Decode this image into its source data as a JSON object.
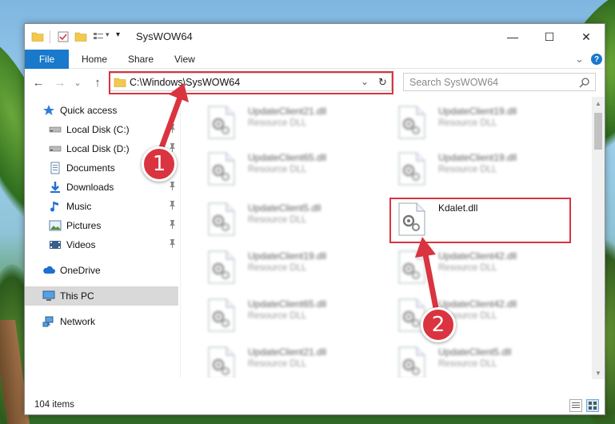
{
  "window": {
    "title": "SysWOW64",
    "minimize": "—",
    "maximize": "☐",
    "close": "✕"
  },
  "ribbon": {
    "tabs": [
      "File",
      "Home",
      "Share",
      "View"
    ],
    "collapse": "⌄",
    "help": "?"
  },
  "navbar": {
    "back": "←",
    "forward": "→",
    "recent": "⌄",
    "up": "↑",
    "address": "C:\\Windows\\SysWOW64",
    "dropdown": "⌄",
    "refresh": "↻",
    "search_placeholder": "Search SysWOW64"
  },
  "sidebar": {
    "items": [
      {
        "label": "Quick access",
        "icon": "star-icon",
        "pinned": false
      },
      {
        "label": "Local Disk (C:)",
        "icon": "drive-icon",
        "pinned": true
      },
      {
        "label": "Local Disk (D:)",
        "icon": "drive-icon",
        "pinned": true
      },
      {
        "label": "Documents",
        "icon": "documents-icon",
        "pinned": true
      },
      {
        "label": "Downloads",
        "icon": "download-icon",
        "pinned": true
      },
      {
        "label": "Music",
        "icon": "music-icon",
        "pinned": true
      },
      {
        "label": "Pictures",
        "icon": "pictures-icon",
        "pinned": true
      },
      {
        "label": "Videos",
        "icon": "videos-icon",
        "pinned": true
      },
      {
        "label": "OneDrive",
        "icon": "cloud-icon",
        "pinned": false
      },
      {
        "label": "This PC",
        "icon": "computer-icon",
        "pinned": false
      },
      {
        "label": "Network",
        "icon": "network-icon",
        "pinned": false
      }
    ],
    "pin_glyph": "📌"
  },
  "files": [
    {
      "name": "UpdateClient21.dll",
      "type": "Resource DLL",
      "blurred": true
    },
    {
      "name": "UpdateClient19.dll",
      "type": "Resource DLL",
      "blurred": true
    },
    {
      "name": "UpdateClient65.dll",
      "type": "Resource DLL",
      "blurred": true
    },
    {
      "name": "UpdateClient19.dll",
      "type": "Resource DLL",
      "blurred": true
    },
    {
      "name": "UpdateClient5.dll",
      "type": "Resource DLL",
      "blurred": true
    },
    {
      "name": "Kdalet.dll",
      "type": "",
      "blurred": false
    },
    {
      "name": "UpdateClient19.dll",
      "type": "Resource DLL",
      "blurred": true
    },
    {
      "name": "UpdateClient42.dll",
      "type": "Resource DLL",
      "blurred": true
    },
    {
      "name": "UpdateClient65.dll",
      "type": "Resource DLL",
      "blurred": true
    },
    {
      "name": "UpdateClient42.dll",
      "type": "Resource DLL",
      "blurred": true
    },
    {
      "name": "UpdateClient21.dll",
      "type": "Resource DLL",
      "blurred": true
    },
    {
      "name": "UpdateClient5.dll",
      "type": "Resource DLL",
      "blurred": true
    }
  ],
  "status": {
    "item_count": "104 items"
  },
  "annotations": {
    "step1": "1",
    "step2": "2",
    "color": "#d9343f"
  }
}
